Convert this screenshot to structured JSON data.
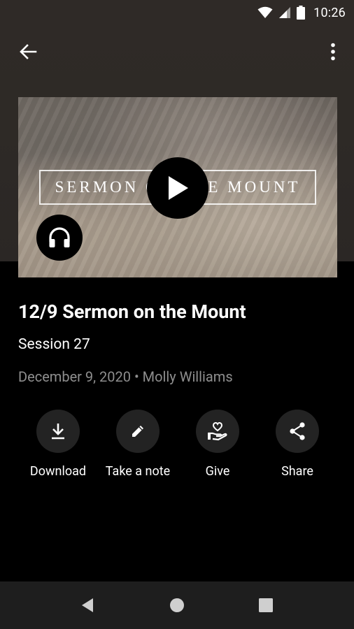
{
  "status_bar": {
    "time": "10:26",
    "icons": [
      "wifi-icon",
      "signal-icon",
      "battery-icon"
    ]
  },
  "app_bar": {
    "back_icon": "arrow-left-icon",
    "menu_icon": "more-vertical-icon"
  },
  "video": {
    "overlay_title": "SERMON ON THE MOUNT",
    "play_icon": "play-icon",
    "audio_icon": "headphones-icon"
  },
  "sermon": {
    "title": "12/9 Sermon on the Mount",
    "session": "Session 27",
    "meta": "December 9, 2020 • Molly Williams"
  },
  "actions": [
    {
      "label": "Download",
      "icon": "download-icon"
    },
    {
      "label": "Take a note",
      "icon": "pencil-icon"
    },
    {
      "label": "Give",
      "icon": "give-heart-hand-icon"
    },
    {
      "label": "Share",
      "icon": "share-icon"
    }
  ],
  "nav": [
    "back-triangle-icon",
    "home-circle-icon",
    "recents-square-icon"
  ],
  "colors": {
    "background": "#000000",
    "header": "#2f2a27",
    "action_circle": "#232323",
    "meta_text": "#8e8e8e",
    "navbar": "#1e1e1e"
  }
}
